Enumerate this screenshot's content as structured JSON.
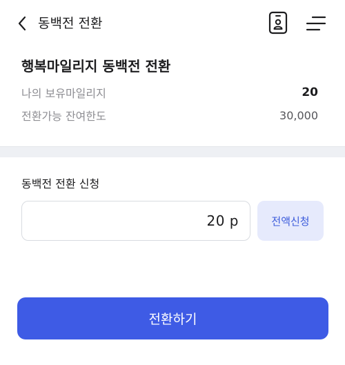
{
  "header": {
    "title": "동백전 전환",
    "icons": {
      "back": "chevron-left-icon",
      "card": "id-card-icon",
      "menu": "menu-icon"
    }
  },
  "summary": {
    "title": "행복마일리지 동백전 전환",
    "owned_label": "나의 보유마일리지",
    "owned_value": "20",
    "limit_label": "전환가능 잔여한도",
    "limit_value": "30,000"
  },
  "apply": {
    "label": "동백전 전환 신청",
    "amount_value": "20 p",
    "full_button_label": "전액신청"
  },
  "submit": {
    "label": "전환하기"
  },
  "colors": {
    "primary": "#3e5be5",
    "full_button_bg": "#e6eafc",
    "full_button_text": "#3b5bdb",
    "divider": "#eef0f4"
  }
}
